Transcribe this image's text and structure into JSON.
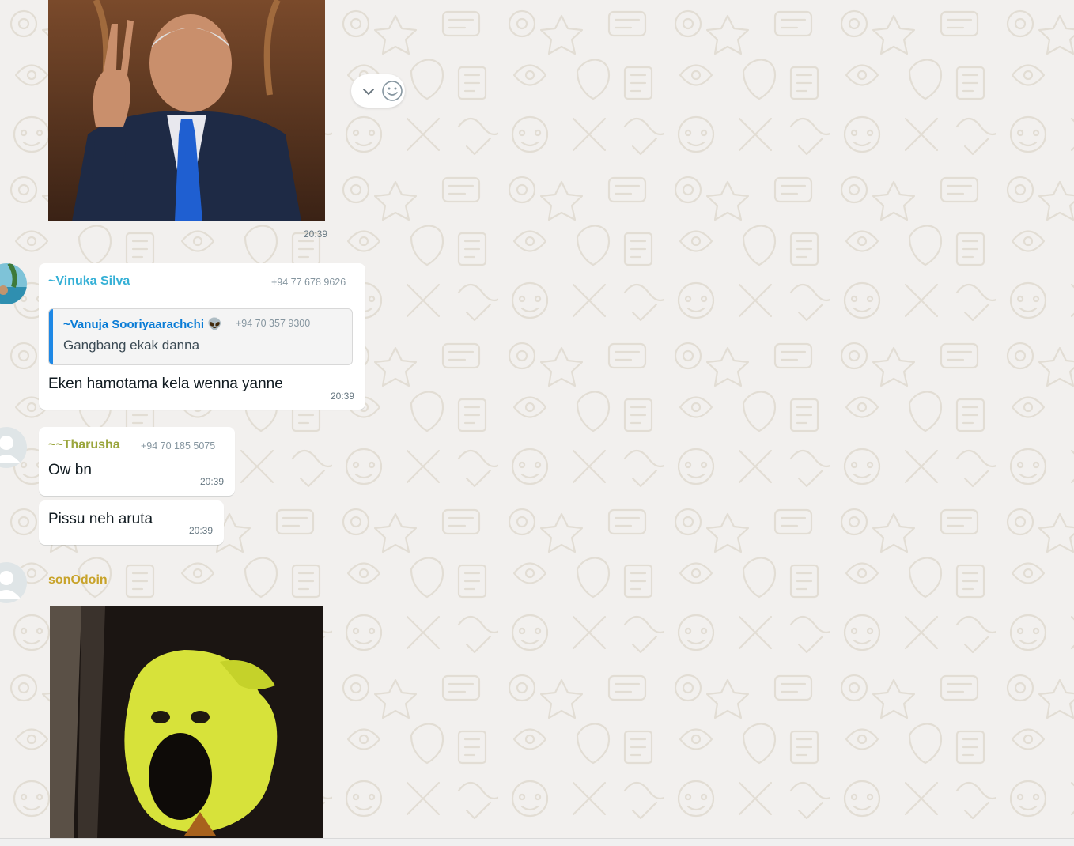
{
  "colors": {
    "chat_background": "#efeae2",
    "bubble": "#ffffff",
    "sender_vinuka": "#35b0d6",
    "sender_vanuja": "#0a7cd6",
    "sender_tharusha": "#9aa53c",
    "sender_sonodoin": "#c8a32a",
    "quote_bar": "#1e88e5"
  },
  "messages": [
    {
      "type": "image",
      "image_icon": "photo-man-peace-sign",
      "time": "20:39",
      "actions": {
        "dropdown_icon": "chevron-down-icon",
        "react_icon": "smiley-icon"
      }
    },
    {
      "type": "reply",
      "sender": "~Vinuka Silva",
      "phone": "+94 77 678 9626",
      "avatar_icon": "avatar-photo",
      "quoted": {
        "sender": "~Vanuja Sooriyaarachchi",
        "sender_emoji": "👽",
        "phone": "+94 70 357 9300",
        "text": "Gangbang ekak danna"
      },
      "text": "Eken hamotama kela wenna yanne",
      "time": "20:39"
    },
    {
      "type": "text",
      "sender": "~~Tharusha",
      "phone": "+94 70 185 5075",
      "avatar_icon": "default-avatar-icon",
      "text": "Ow bn",
      "time": "20:39"
    },
    {
      "type": "text",
      "text": "Pissu neh aruta",
      "time": "20:39"
    },
    {
      "type": "image",
      "sender": "sonOdoin",
      "avatar_icon": "default-avatar-icon",
      "image_icon": "sticker-yellow-creature"
    }
  ]
}
